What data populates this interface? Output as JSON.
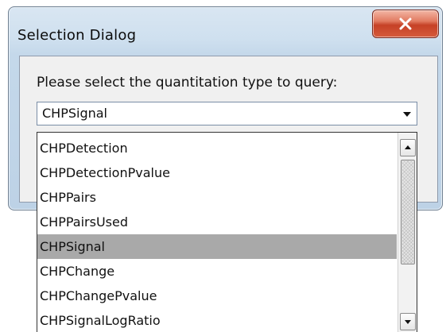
{
  "window": {
    "title": "Selection Dialog",
    "close_icon": "close-icon"
  },
  "dialog": {
    "prompt": "Please select the quantitation type to query:",
    "combo": {
      "selected_value": "CHPSignal",
      "dropdown_icon": "chevron-down-icon"
    },
    "dropdown": {
      "items": [
        {
          "label": "CHPDetection"
        },
        {
          "label": "CHPDetectionPvalue"
        },
        {
          "label": "CHPPairs"
        },
        {
          "label": "CHPPairsUsed"
        },
        {
          "label": "CHPSignal"
        },
        {
          "label": "CHPChange"
        },
        {
          "label": "CHPChangePvalue"
        },
        {
          "label": "CHPSignalLogRatio"
        }
      ],
      "selected_label": "CHPSignal"
    },
    "scrollbar": {
      "up_icon": "arrow-up-icon",
      "down_icon": "arrow-down-icon"
    }
  }
}
